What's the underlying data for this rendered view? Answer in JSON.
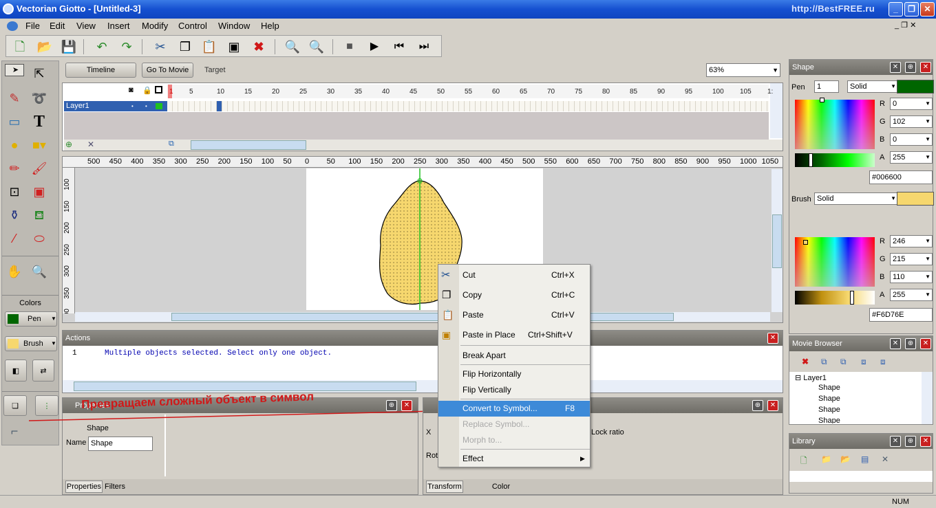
{
  "window": {
    "title": "Vectorian Giotto - [Untitled-3]",
    "watermark": "http://BestFREE.ru"
  },
  "menu": [
    "File",
    "Edit",
    "View",
    "Insert",
    "Modify",
    "Control",
    "Window",
    "Help"
  ],
  "toolbar": {
    "icons": [
      "new-doc-icon",
      "open-folder-icon",
      "save-icon",
      "undo-icon",
      "redo-icon",
      "cut-icon",
      "copy-icon",
      "paste-icon",
      "paste-in-place-icon",
      "delete-icon",
      "zoom-in-icon",
      "zoom-out-icon",
      "stop-icon",
      "play-icon",
      "rewind-icon",
      "step-forward-icon"
    ]
  },
  "tabs": {
    "timeline": "Timeline",
    "go_to_movie": "Go To Movie",
    "target": "Target",
    "zoom": "63%"
  },
  "timeline": {
    "frames": [
      "1",
      "5",
      "10",
      "15",
      "20",
      "25",
      "30",
      "35",
      "40",
      "45",
      "50",
      "55",
      "60",
      "65",
      "70",
      "75",
      "80",
      "85",
      "90",
      "95",
      "100",
      "105",
      "1:"
    ],
    "layer": "Layer1"
  },
  "ruler": {
    "h": [
      "500",
      "450",
      "400",
      "350",
      "300",
      "250",
      "200",
      "150",
      "100",
      "50",
      "0",
      "50",
      "100",
      "150",
      "200",
      "250",
      "300",
      "350",
      "400",
      "450",
      "500",
      "550",
      "600",
      "650",
      "700",
      "750",
      "800",
      "850",
      "900",
      "950",
      "1000",
      "1050",
      "1"
    ],
    "v": [
      "100",
      "150",
      "200",
      "250",
      "300",
      "350",
      "400"
    ]
  },
  "colors": {
    "header": "Colors",
    "pen": "Pen",
    "brush": "Brush",
    "pen_color": "#006600",
    "brush_color": "#F6D76E"
  },
  "actions": {
    "title": "Actions",
    "line_no": "1",
    "text": "Multiple objects selected. Select only one object."
  },
  "properties": {
    "title": "Properties",
    "overlay": "Превращаем сложный объект в символ",
    "shape_label": "Shape",
    "name_label": "Name",
    "name_value": "Shape",
    "tab1": "Properties",
    "tab2": "Filters"
  },
  "transform": {
    "x_label": "X",
    "rot_label": "Rot",
    "lock_ratio": "Lock ratio",
    "tab1": "Transform",
    "tab2": "Color Transformation"
  },
  "context_menu": [
    {
      "label": "Cut",
      "shortcut": "Ctrl+X",
      "icon": "cut-icon"
    },
    {
      "label": "Copy",
      "shortcut": "Ctrl+C",
      "icon": "copy-icon"
    },
    {
      "label": "Paste",
      "shortcut": "Ctrl+V",
      "icon": "paste-icon"
    },
    {
      "label": "Paste in Place",
      "shortcut": "Ctrl+Shift+V",
      "icon": "paste-in-place-icon"
    },
    {
      "label": "Break Apart",
      "shortcut": ""
    },
    {
      "label": "Flip Horizontally",
      "shortcut": ""
    },
    {
      "label": "Flip Vertically",
      "shortcut": ""
    },
    {
      "label": "Convert to Symbol...",
      "shortcut": "F8"
    },
    {
      "label": "Replace Symbol...",
      "shortcut": ""
    },
    {
      "label": "Morph to...",
      "shortcut": ""
    },
    {
      "label": "Effect",
      "shortcut": ""
    }
  ],
  "shape_panel": {
    "title": "Shape",
    "pen": "Pen",
    "pen_width": "1",
    "pen_style": "Solid",
    "brush": "Brush",
    "brush_style": "Solid",
    "pen_rgba": {
      "r": "0",
      "g": "102",
      "b": "0",
      "a": "255"
    },
    "pen_hex": "#006600",
    "brush_rgba": {
      "r": "246",
      "g": "215",
      "b": "110",
      "a": "255"
    },
    "brush_hex": "#F6D76E",
    "labels": {
      "r": "R",
      "g": "G",
      "b": "B",
      "a": "A"
    }
  },
  "movie_browser": {
    "title": "Movie Browser",
    "root": "Layer1",
    "items": [
      "Shape",
      "Shape",
      "Shape",
      "Shape"
    ]
  },
  "library": {
    "title": "Library"
  },
  "status": {
    "num": "NUM"
  }
}
